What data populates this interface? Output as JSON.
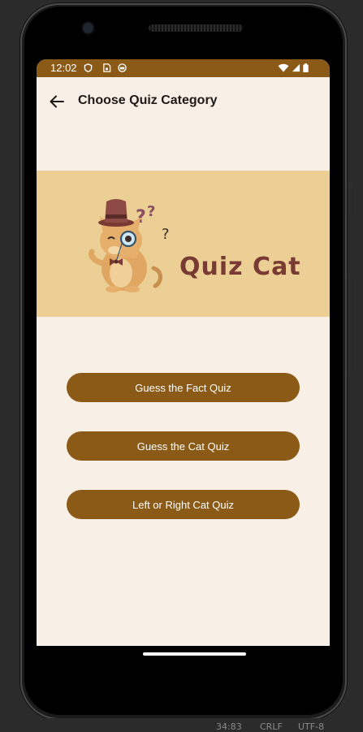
{
  "status_bar": {
    "time": "12:02",
    "left_icons": [
      "shield-icon",
      "sim-lock-icon",
      "robot-face-icon"
    ],
    "right_icons": [
      "wifi-icon",
      "signal-icon",
      "battery-icon"
    ],
    "color": "#8a5a16"
  },
  "app_bar": {
    "back_icon": "arrow-back-icon",
    "title": "Choose Quiz Category"
  },
  "banner": {
    "title": "Quiz Cat",
    "illustration": "detective-cat-illustration",
    "background": "#ebcf95",
    "title_color": "#7a3a34"
  },
  "quiz_buttons": [
    {
      "label": "Guess the Fact Quiz"
    },
    {
      "label": "Guess the Cat Quiz"
    },
    {
      "label": "Left or Right Cat Quiz"
    }
  ],
  "ide_status": {
    "position": "34:83",
    "line_ending": "CRLF",
    "encoding": "UTF-8"
  },
  "colors": {
    "screen_background": "#f8efe7",
    "button_background": "#8a5a16",
    "button_text": "#ffffff"
  }
}
